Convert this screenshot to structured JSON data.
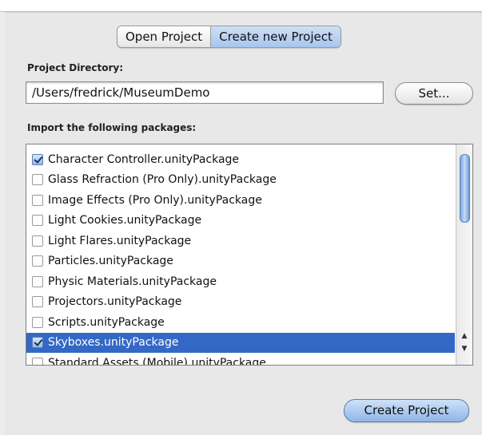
{
  "tabs": [
    {
      "label": "Open Project",
      "selected": false
    },
    {
      "label": "Create new Project",
      "selected": true
    }
  ],
  "project_directory": {
    "label": "Project Directory:",
    "value": "/Users/fredrick/MuseumDemo",
    "set_button": "Set..."
  },
  "packages": {
    "label": "Import the following packages:",
    "items": [
      {
        "label": "Character Controller.unityPackage",
        "checked": true,
        "selected": false
      },
      {
        "label": "Glass Refraction (Pro Only).unityPackage",
        "checked": false,
        "selected": false
      },
      {
        "label": "Image Effects (Pro Only).unityPackage",
        "checked": false,
        "selected": false
      },
      {
        "label": "Light Cookies.unityPackage",
        "checked": false,
        "selected": false
      },
      {
        "label": "Light Flares.unityPackage",
        "checked": false,
        "selected": false
      },
      {
        "label": "Particles.unityPackage",
        "checked": false,
        "selected": false
      },
      {
        "label": "Physic Materials.unityPackage",
        "checked": false,
        "selected": false
      },
      {
        "label": "Projectors.unityPackage",
        "checked": false,
        "selected": false
      },
      {
        "label": "Scripts.unityPackage",
        "checked": false,
        "selected": false
      },
      {
        "label": "Skyboxes.unityPackage",
        "checked": true,
        "selected": true
      },
      {
        "label": "Standard Assets (Mobile).unityPackage",
        "checked": false,
        "selected": false
      }
    ]
  },
  "create_button": "Create Project",
  "colors": {
    "selection": "#3468c6",
    "accent_button": "#8fb6e8"
  }
}
